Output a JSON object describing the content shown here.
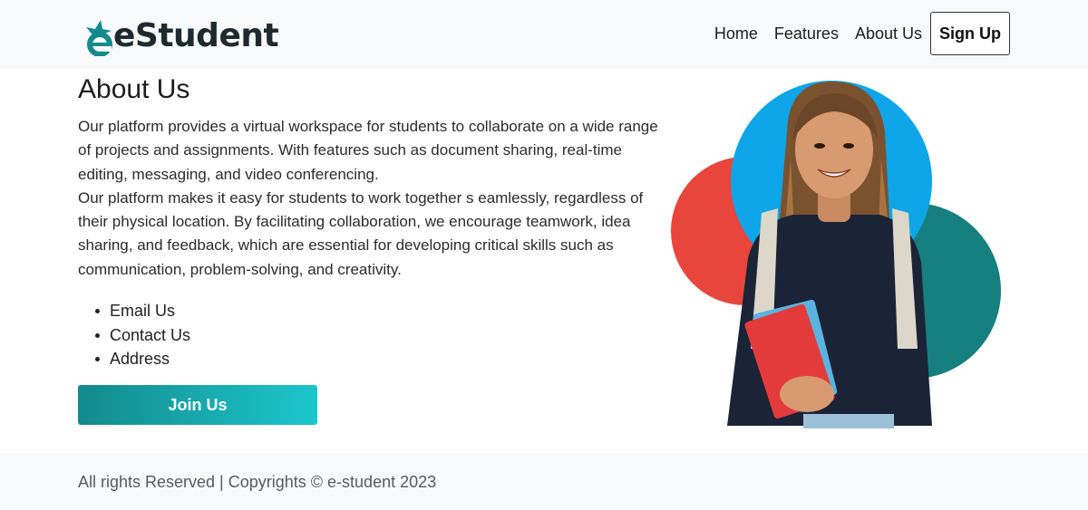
{
  "brand": {
    "name": "eStudent",
    "primary_color": "#148a8c",
    "text_color": "#1f2a30"
  },
  "nav": {
    "links": [
      {
        "label": "Home"
      },
      {
        "label": "Features"
      },
      {
        "label": "About Us"
      }
    ],
    "signup_label": "Sign Up"
  },
  "about": {
    "title": "About Us",
    "paragraph1": "Our platform provides a virtual workspace for students to collaborate on a wide range of projects and assignments. With features such as document sharing, real-time editing, messaging, and video conferencing.",
    "paragraph2": "Our platform makes it easy for students to work together s eamlessly, regardless of their physical location. By facilitating collaboration, we encourage teamwork, idea sharing, and feedback, which are essential for developing critical skills such as communication, problem-solving, and creativity.",
    "links": [
      "Email Us",
      "Contact Us",
      "Address"
    ],
    "join_label": "Join Us"
  },
  "hero": {
    "icon": "student-photo",
    "circle_colors": [
      "#e8453c",
      "#0ea5e9",
      "#167f80"
    ]
  },
  "footer": {
    "text": "All rights Reserved | Copyrights © e-student 2023"
  }
}
